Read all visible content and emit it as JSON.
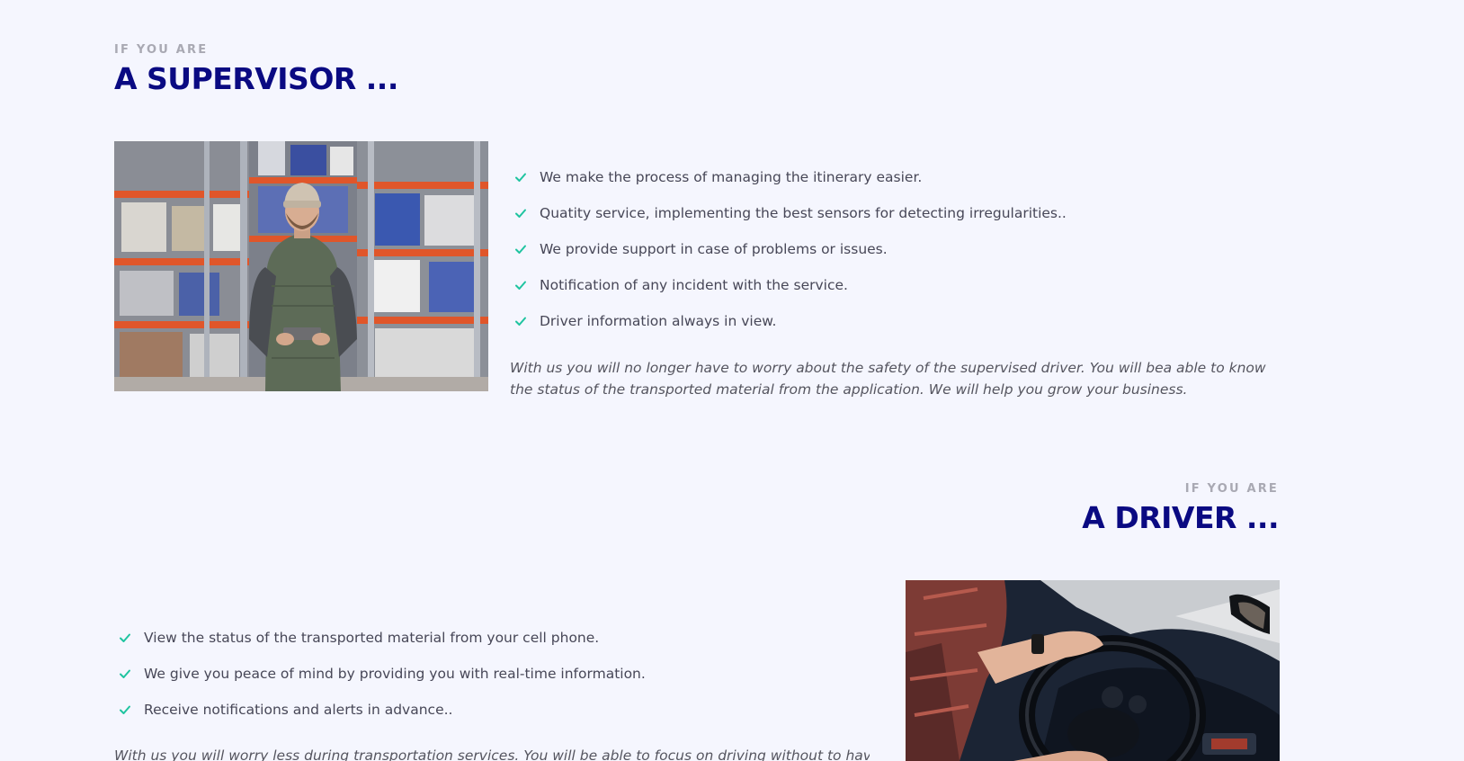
{
  "supervisor": {
    "eyebrow": "IF YOU ARE",
    "title": "A SUPERVISOR ...",
    "photo": "warehouse-worker-photo",
    "items": [
      "We make the process of managing the itinerary easier.",
      "Quatity service, implementing the best sensors for detecting irregularities..",
      "We provide support in case of problems or issues.",
      "Notification of any incident with the service.",
      "Driver information always in view."
    ],
    "note": "With us you will no longer have to worry about the safety of the supervised driver. You will bea able to know the status of the transported material from the application. We will help you grow your business."
  },
  "driver": {
    "eyebrow": "IF YOU ARE",
    "title": "A DRIVER ...",
    "photo": "car-driver-photo",
    "items": [
      "View the status of the transported material from your cell phone.",
      "We give you peace of mind by providing you with real-time information.",
      "Receive notifications and alerts in advance.."
    ],
    "note": "With us you will worry less during transportation services. You will be able to focus on driving without to having to"
  },
  "colors": {
    "background": "#f5f6fe",
    "heading": "#0a0a82",
    "eyebrow": "#a9a9b3",
    "check": "#1fc4a0",
    "text": "#474757"
  },
  "icons": {
    "check": "check-icon"
  }
}
